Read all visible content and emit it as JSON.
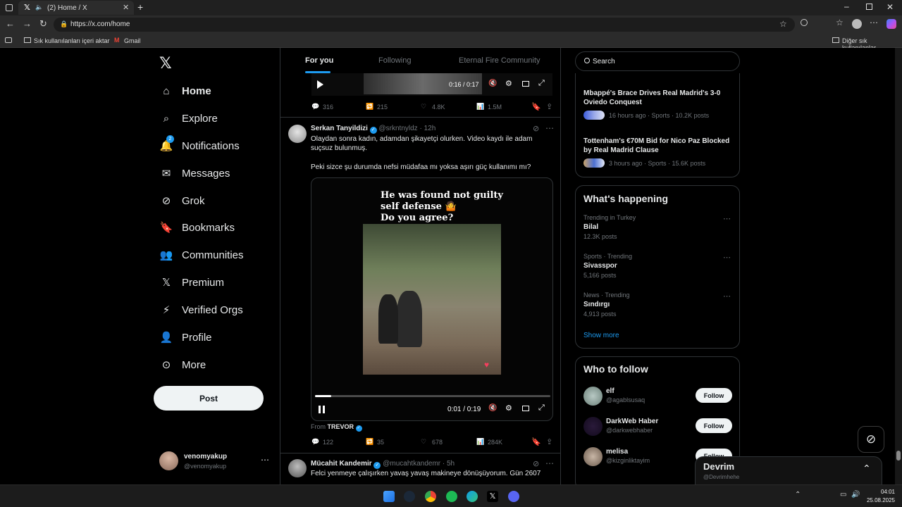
{
  "browser": {
    "tab_title": "(2) Home / X",
    "url": "https://x.com/home",
    "bookmarks": [
      "Sık kullanılanları içeri aktar",
      "Gmail"
    ],
    "other_favorites": "Diğer sık kullanılanlar"
  },
  "nav": {
    "items": [
      {
        "label": "Home",
        "icon": "home-icon"
      },
      {
        "label": "Explore",
        "icon": "search-icon"
      },
      {
        "label": "Notifications",
        "icon": "bell-icon",
        "badge": "2"
      },
      {
        "label": "Messages",
        "icon": "mail-icon"
      },
      {
        "label": "Grok",
        "icon": "grok-icon"
      },
      {
        "label": "Bookmarks",
        "icon": "bookmark-icon"
      },
      {
        "label": "Communities",
        "icon": "communities-icon"
      },
      {
        "label": "Premium",
        "icon": "x-logo-icon"
      },
      {
        "label": "Verified Orgs",
        "icon": "lightning-icon"
      },
      {
        "label": "Profile",
        "icon": "person-icon"
      },
      {
        "label": "More",
        "icon": "more-circle-icon"
      }
    ],
    "post_label": "Post",
    "account": {
      "name": "venomyakup",
      "handle": "@venomyakup"
    }
  },
  "feed": {
    "tabs": [
      "For you",
      "Following",
      "Eternal Fire Community"
    ],
    "top_video": {
      "time": "0:16 / 0:17"
    },
    "top_stats": {
      "replies": "316",
      "reposts": "215",
      "likes": "4.8K",
      "views": "1.5M"
    },
    "post": {
      "author": "Serkan Tanyildizi",
      "handle": "@srkntnyldz",
      "time": "· 12h",
      "text1": "Olaydan sonra kadın, adamdan şikayetçi olurken. Video kaydı ile adam suçsuz bulunmuş.",
      "text2": "Peki sizce şu durumda nefsi müdafaa mı yoksa aşırı güç kullanımı mı?",
      "overlay_lines": [
        "He was found not guilty",
        "self defense 🤷",
        "Do you agree?"
      ],
      "video_time": "0:01 / 0:19",
      "from_label": "From",
      "from_name": "TREVOR",
      "progress": 0.07,
      "stats": {
        "replies": "122",
        "reposts": "35",
        "likes": "678",
        "views": "284K"
      }
    },
    "next_post": {
      "author": "Mücahit Kandemir",
      "handle": "@mucahtkandemr",
      "time": "· 5h",
      "text": "Felci yenmeye çalışırken yavaş yavaş makineye dönüşüyorum. Gün 2607"
    }
  },
  "right": {
    "search_placeholder": "Search",
    "news": [
      {
        "title": "Mbappé's Brace Drives Real Madrid's 3-0 Oviedo Conquest",
        "meta": "16 hours ago · Sports · 10.2K posts"
      },
      {
        "title": "Tottenham's €70M Bid for Nico Paz Blocked by Real Madrid Clause",
        "meta": "3 hours ago · Sports · 15.6K posts"
      }
    ],
    "whats_happening": "What's happening",
    "trends": [
      {
        "meta": "Trending in Turkey",
        "name": "Bilal",
        "posts": "12.3K posts"
      },
      {
        "meta": "Sports · Trending",
        "name": "Sivasspor",
        "posts": "5,166 posts"
      },
      {
        "meta": "News · Trending",
        "name": "Sındırgı",
        "posts": "4,913 posts"
      }
    ],
    "show_more": "Show more",
    "who_to_follow": "Who to follow",
    "follow_label": "Follow",
    "suggestions": [
      {
        "name": "elf",
        "handle": "@agablsusaq"
      },
      {
        "name": "DarkWeb Haber",
        "handle": "@darkwebhaber"
      },
      {
        "name": "melisa",
        "handle": "@kizginliktayim"
      }
    ]
  },
  "messages_drawer": {
    "name": "Devrim",
    "handle": "@Devrimhehe"
  },
  "taskbar": {
    "time": "04:01",
    "date": "25.08.2025"
  },
  "colors": {
    "accent": "#1d9bf0",
    "background": "#000000",
    "border": "#2f3336"
  }
}
